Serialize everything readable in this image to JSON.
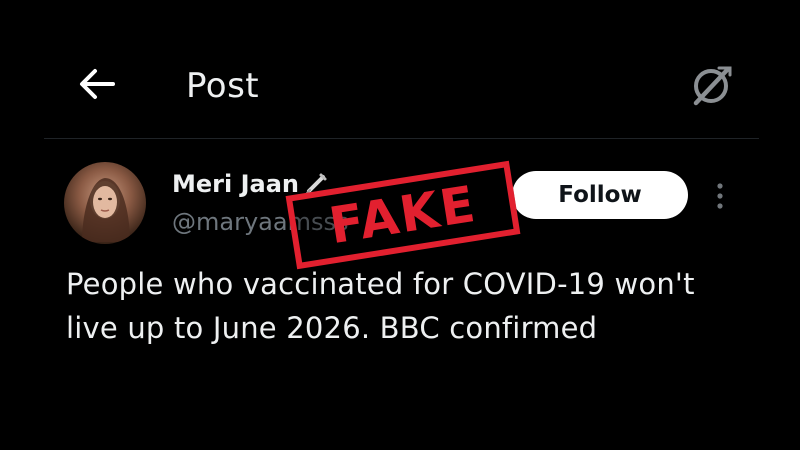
{
  "header": {
    "title": "Post",
    "back_icon": "arrow-left-icon",
    "grok_icon": "grok-icon"
  },
  "post": {
    "user_name": "Meri Jaan",
    "user_handle": "@maryaamsss",
    "follow_label": "Follow",
    "more_icon": "more-vertical-icon",
    "text": "People who vaccinated for COVID-19 won't live up to June 2026. BBC confirmed"
  },
  "stamp": {
    "text": "FAKE",
    "color": "#e2202f"
  },
  "colors": {
    "background": "#000000",
    "text_primary": "#eef0f1",
    "text_secondary": "#6e767d",
    "follow_button_bg": "#ffffff"
  }
}
